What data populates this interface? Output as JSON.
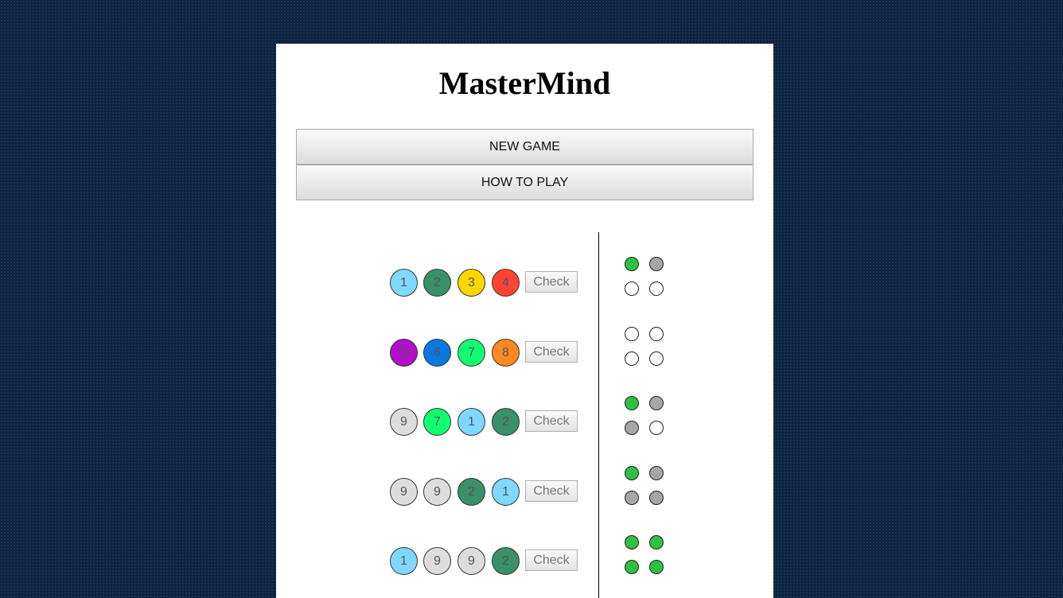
{
  "title": "MasterMind",
  "menu": {
    "new_game": "NEW GAME",
    "how_to_play": "HOW TO PLAY"
  },
  "colors": {
    "1": "#7fd8ff",
    "2": "#3a9068",
    "3": "#ffd700",
    "4": "#ff4433",
    "5": "#b010c8",
    "6": "#0a78e0",
    "7": "#10ff70",
    "8": "#ff8820",
    "9": "#dddddd"
  },
  "feedback_colors": {
    "black": "#2ec040",
    "white": "#a6a6a6",
    "empty": "#ffffff"
  },
  "rows": [
    {
      "guess": [
        "1",
        "2",
        "3",
        "4"
      ],
      "check_label": "Check",
      "feedback": [
        "black",
        "white",
        "empty",
        "empty"
      ]
    },
    {
      "guess": [
        "5",
        "6",
        "7",
        "8"
      ],
      "check_label": "Check",
      "feedback": [
        "empty",
        "empty",
        "empty",
        "empty"
      ]
    },
    {
      "guess": [
        "9",
        "7",
        "1",
        "2"
      ],
      "check_label": "Check",
      "feedback": [
        "black",
        "white",
        "white",
        "empty"
      ]
    },
    {
      "guess": [
        "9",
        "9",
        "2",
        "1"
      ],
      "check_label": "Check",
      "feedback": [
        "black",
        "white",
        "white",
        "white"
      ]
    },
    {
      "guess": [
        "1",
        "9",
        "9",
        "2"
      ],
      "check_label": "Check",
      "feedback": [
        "black",
        "black",
        "black",
        "black"
      ]
    }
  ]
}
